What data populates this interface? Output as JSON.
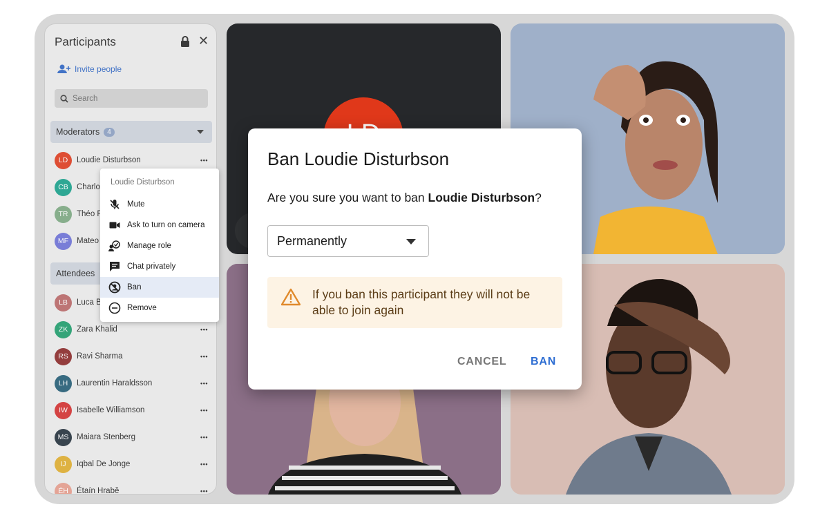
{
  "panel": {
    "title": "Participants",
    "invite_label": "Invite people",
    "search_placeholder": "Search",
    "moderators": {
      "label": "Moderators",
      "count": "4",
      "items": [
        {
          "initials": "LD",
          "name": "Loudie Disturbson",
          "color": "#e0381a"
        },
        {
          "initials": "CB",
          "name": "Charlot",
          "color": "#13a08a"
        },
        {
          "initials": "TR",
          "name": "Théo R",
          "color": "#7aa880"
        },
        {
          "initials": "MF",
          "name": "Mateo",
          "color": "#6a6fd8"
        }
      ]
    },
    "attendees": {
      "label": "Attendees",
      "items": [
        {
          "initials": "LB",
          "name": "Luca B",
          "color": "#b96565"
        },
        {
          "initials": "ZK",
          "name": "Zara Khalid",
          "color": "#1a9c6a"
        },
        {
          "initials": "RS",
          "name": "Ravi Sharma",
          "color": "#8a2424"
        },
        {
          "initials": "LH",
          "name": "Laurentin Haraldsson",
          "color": "#1f5a73"
        },
        {
          "initials": "IW",
          "name": "Isabelle Williamson",
          "color": "#d42b2b"
        },
        {
          "initials": "MS",
          "name": "Maiara Stenberg",
          "color": "#1e2c38"
        },
        {
          "initials": "IJ",
          "name": "Iqbal De Jonge",
          "color": "#e0ad2a"
        },
        {
          "initials": "ÉH",
          "name": "Étaín Hrabě",
          "color": "#e79c8c"
        }
      ]
    }
  },
  "tile1": {
    "initials": "LD",
    "avatar_color": "#e0381a"
  },
  "context_menu": {
    "header": "Loudie Disturbson",
    "items": [
      {
        "label": "Mute",
        "icon": "mic-off-icon"
      },
      {
        "label": "Ask to turn on camera",
        "icon": "video-camera-icon"
      },
      {
        "label": "Manage role",
        "icon": "manage-role-icon"
      },
      {
        "label": "Chat privately",
        "icon": "chat-icon"
      },
      {
        "label": "Ban",
        "icon": "ban-icon"
      },
      {
        "label": "Remove",
        "icon": "remove-icon"
      }
    ]
  },
  "dialog": {
    "title": "Ban Loudie Disturbson",
    "question_prefix": "Are you sure you want to ban ",
    "question_name": "Loudie Disturbson",
    "question_suffix": "?",
    "duration_value": "Permanently",
    "warning": "If you ban this participant they will not be able to join again",
    "cancel_label": "CANCEL",
    "ban_label": "BAN"
  },
  "colors": {
    "accent": "#2d6dd2",
    "warning_bg": "#fdf3e4",
    "warning_icon": "#e08a2c"
  }
}
